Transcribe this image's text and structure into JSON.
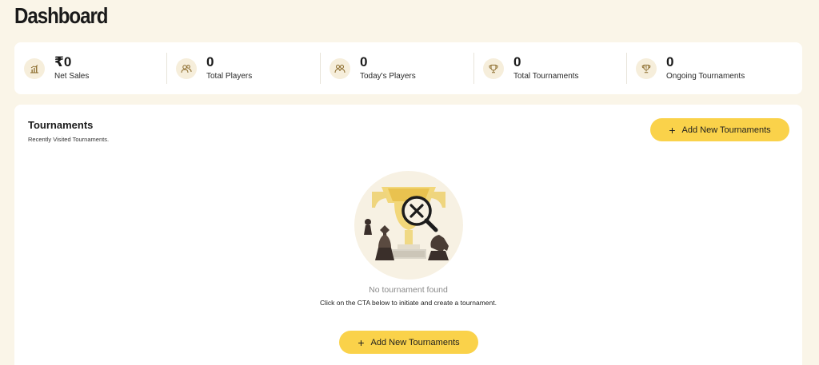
{
  "page": {
    "title": "Dashboard"
  },
  "stats": [
    {
      "value": "₹0",
      "label": "Net Sales",
      "icon": "chart-icon"
    },
    {
      "value": "0",
      "label": "Total Players",
      "icon": "users-icon"
    },
    {
      "value": "0",
      "label": "Today's Players",
      "icon": "players-icon"
    },
    {
      "value": "0",
      "label": "Total Tournaments",
      "icon": "trophy-icon"
    },
    {
      "value": "0",
      "label": "Ongoing Tournaments",
      "icon": "award-icon"
    }
  ],
  "tournaments": {
    "title": "Tournaments",
    "subtitle": "Recently Visited Tournaments.",
    "add_button_label": "Add New Tournaments",
    "empty_title": "No tournament found",
    "empty_description": "Click on the CTA below to initiate and create a tournament.",
    "empty_button_label": "Add New Tournaments"
  },
  "colors": {
    "background": "#faf5e8",
    "accent": "#fad24a",
    "icon_bg": "#f6eedb",
    "icon_stroke": "#8a6a2a"
  }
}
